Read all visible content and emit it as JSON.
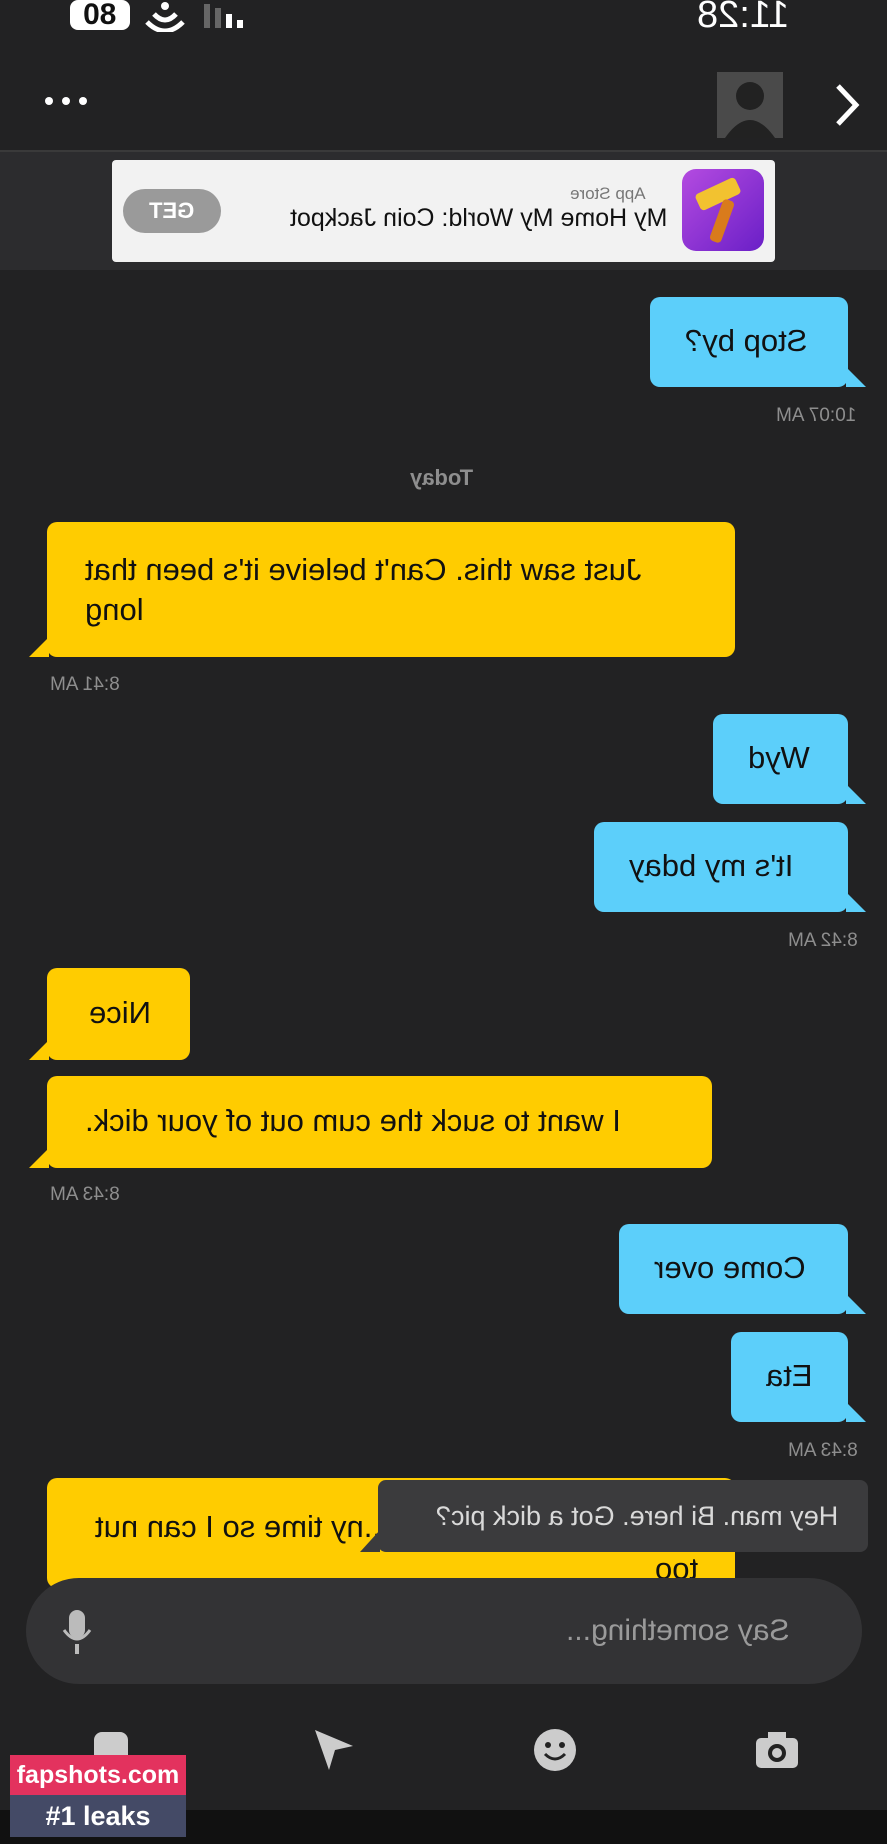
{
  "status": {
    "time": "11:28",
    "battery": "80"
  },
  "header": {
    "menu_icon": "ellipsis-icon",
    "next_icon": "chevron-right-icon"
  },
  "ad": {
    "source": "App Store",
    "title": "My Home My World: Coin Jackpot",
    "button": "GET"
  },
  "messages": [
    {
      "side": "right",
      "text": "Stop by?"
    },
    {
      "timestamp": "10:07 AM"
    },
    {
      "day": "Today"
    },
    {
      "side": "left",
      "text": "Just saw this. Can't beleive it's been that long"
    },
    {
      "timestamp": "8:41 AM"
    },
    {
      "side": "right",
      "text": "Wyd"
    },
    {
      "side": "right",
      "text": "It's my bday"
    },
    {
      "timestamp": "8:42 AM"
    },
    {
      "side": "left",
      "text": "Nice"
    },
    {
      "side": "left",
      "text": "I want to suck the cum out of your dick."
    },
    {
      "timestamp": "8:43 AM"
    },
    {
      "side": "right",
      "text": "Come over"
    },
    {
      "side": "right",
      "text": "Eta"
    },
    {
      "timestamp": "8:43 AM"
    },
    {
      "side": "left",
      "text_line1": "...ny time so I can nut",
      "text_line2": "too"
    }
  ],
  "tooltip": "Hey man. Bi here. Got a dick pic?",
  "composer": {
    "placeholder": "Say something..."
  },
  "watermark": {
    "line1": "fapshots.com",
    "line2": "#1 leaks"
  }
}
